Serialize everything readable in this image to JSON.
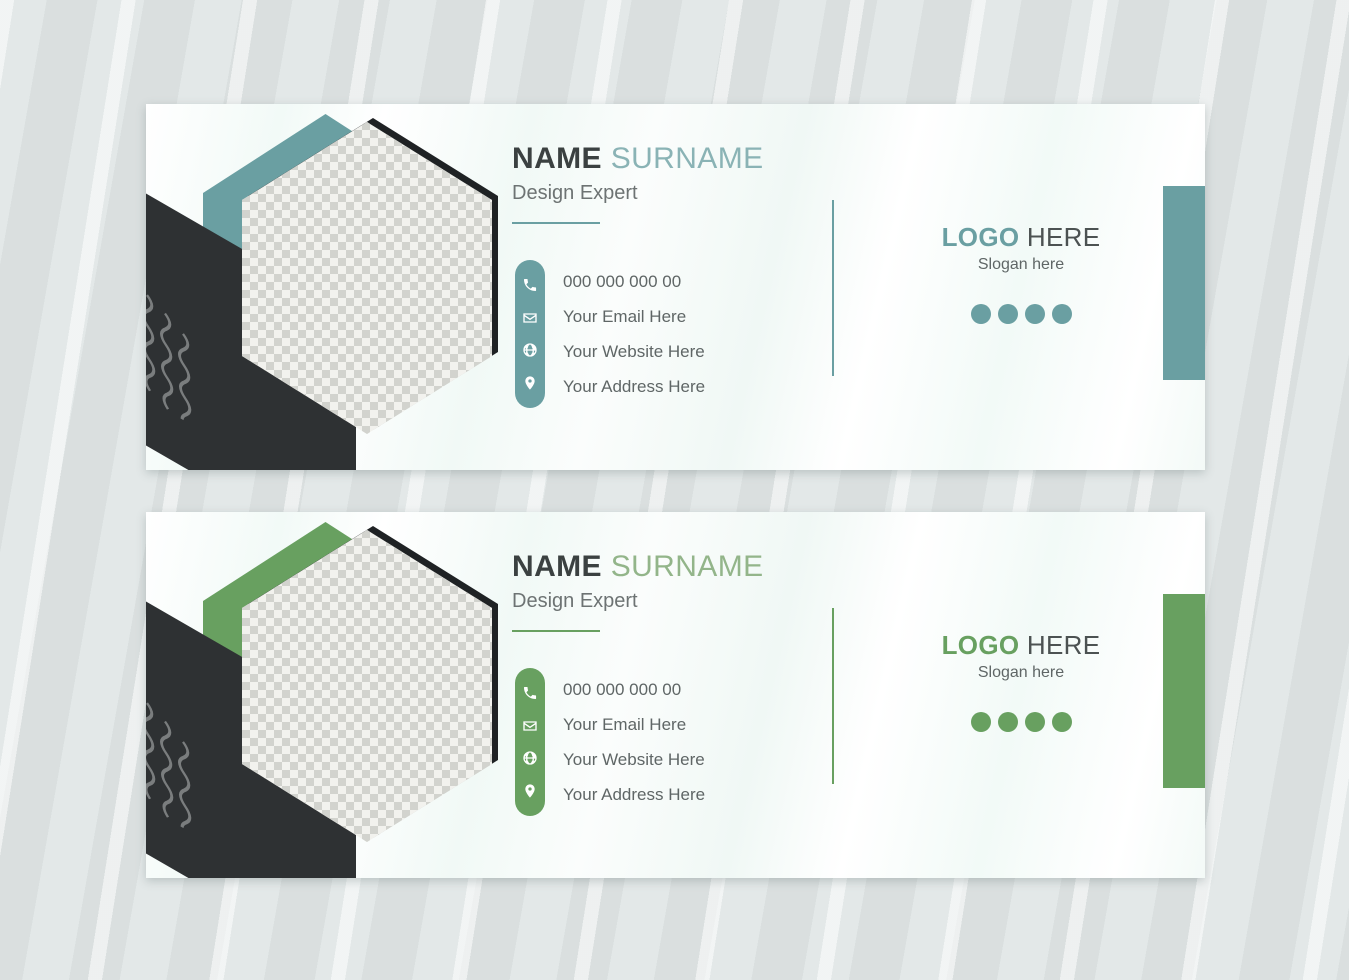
{
  "page": {
    "background_color": "#dfe5e5",
    "stripe_light": "#e3e8e8",
    "stripe_dark": "#dadfdf"
  },
  "cards": [
    {
      "id": "teal",
      "accent_color": "#6a9fa2",
      "accent_light_color": "#8ab3b5",
      "dark_color": "#2e3133",
      "name_first": "NAME",
      "name_last": "SURNAME",
      "role": "Design Expert",
      "contacts": [
        {
          "icon": "phone-icon",
          "text": "000 000 000 00"
        },
        {
          "icon": "envelope-icon",
          "text": "Your Email Here"
        },
        {
          "icon": "globe-icon",
          "text": "Your Website Here"
        },
        {
          "icon": "location-pin-icon",
          "text": "Your Address Here"
        }
      ],
      "logo_bold": "LOGO",
      "logo_regular": "HERE",
      "slogan": "Slogan here",
      "dot_count": 4
    },
    {
      "id": "green",
      "accent_color": "#68a060",
      "accent_light_color": "#93b58a",
      "dark_color": "#2e3133",
      "name_first": "NAME",
      "name_last": "SURNAME",
      "role": "Design Expert",
      "contacts": [
        {
          "icon": "phone-icon",
          "text": "000 000 000 00"
        },
        {
          "icon": "envelope-icon",
          "text": "Your Email Here"
        },
        {
          "icon": "globe-icon",
          "text": "Your Website Here"
        },
        {
          "icon": "location-pin-icon",
          "text": "Your Address Here"
        }
      ],
      "logo_bold": "LOGO",
      "logo_regular": "HERE",
      "slogan": "Slogan here",
      "dot_count": 4
    }
  ]
}
